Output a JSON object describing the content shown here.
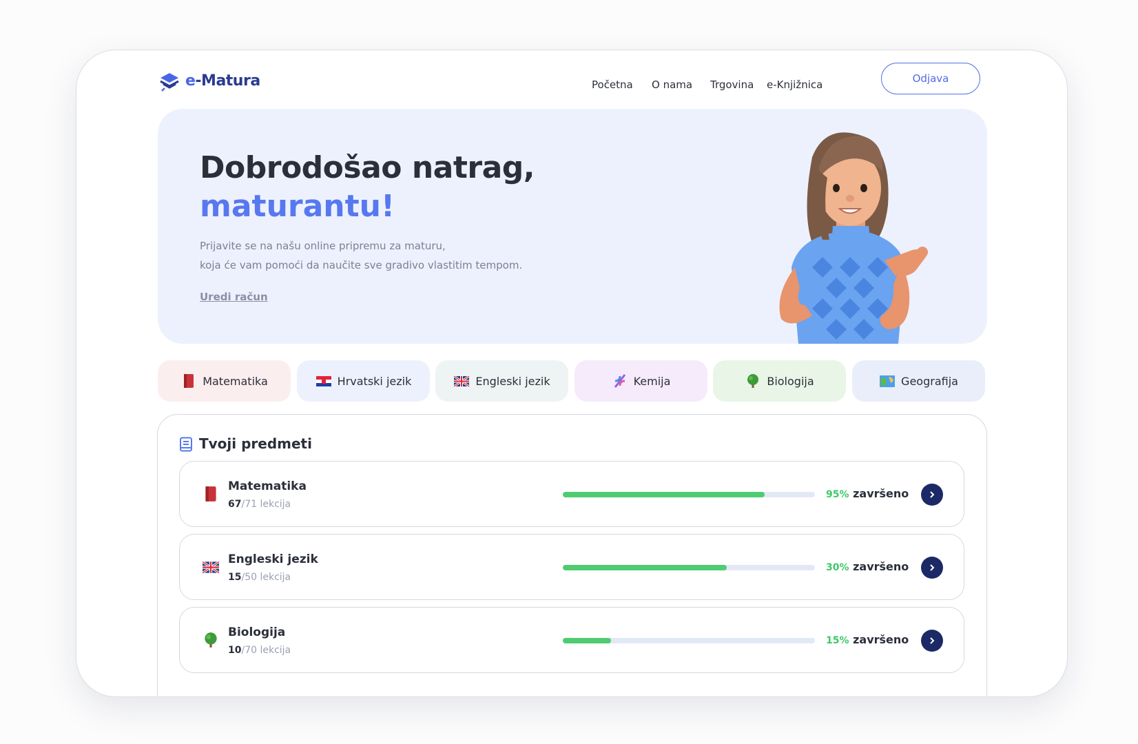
{
  "brand": {
    "prefix": "e",
    "name": "-Matura"
  },
  "nav": {
    "items": [
      "Početna",
      "O nama",
      "Trgovina",
      "e-Knjižnica"
    ],
    "logout_label": "Odjava"
  },
  "hero": {
    "title_line1": "Dobrodošao natrag,",
    "title_line2": "maturantu!",
    "text_line1": "Prijavite se na našu online pripremu za maturu,",
    "text_line2": "koja će vam pomoći da naučite sve gradivo vlastitim tempom.",
    "link": "Uredi račun"
  },
  "chips": [
    {
      "label": "Matematika",
      "icon": "book-icon",
      "bg": "#fbeeee"
    },
    {
      "label": "Hrvatski jezik",
      "icon": "croatia-flag-icon",
      "bg": "#edf1fd"
    },
    {
      "label": "Engleski jezik",
      "icon": "uk-flag-icon",
      "bg": "#eef4f3"
    },
    {
      "label": "Kemija",
      "icon": "dna-icon",
      "bg": "#f5ebfb"
    },
    {
      "label": "Biologija",
      "icon": "tree-icon",
      "bg": "#e9f5e6"
    },
    {
      "label": "Geografija",
      "icon": "map-icon",
      "bg": "#eaeefa"
    }
  ],
  "panel": {
    "title": "Tvoji predmeti",
    "icon": "book-outline-icon",
    "rows": [
      {
        "name": "Matematika",
        "done": "67",
        "total": "/71",
        "lessons_label": "lekcija",
        "percent": "95%",
        "progress": 0.8,
        "status": "završeno",
        "icon": "book-icon"
      },
      {
        "name": "Engleski jezik",
        "done": "15",
        "total": "/50",
        "lessons_label": "lekcija",
        "percent": "30%",
        "progress": 0.65,
        "status": "završeno",
        "icon": "uk-flag-icon"
      },
      {
        "name": "Biologija",
        "done": "10",
        "total": "/70",
        "lessons_label": "lekcija",
        "percent": "15%",
        "progress": 0.19,
        "status": "završeno",
        "icon": "tree-icon"
      }
    ]
  },
  "colors": {
    "accent": "#5778ef",
    "brand_dark": "#1b2a66",
    "progress": "#4fcc72"
  }
}
